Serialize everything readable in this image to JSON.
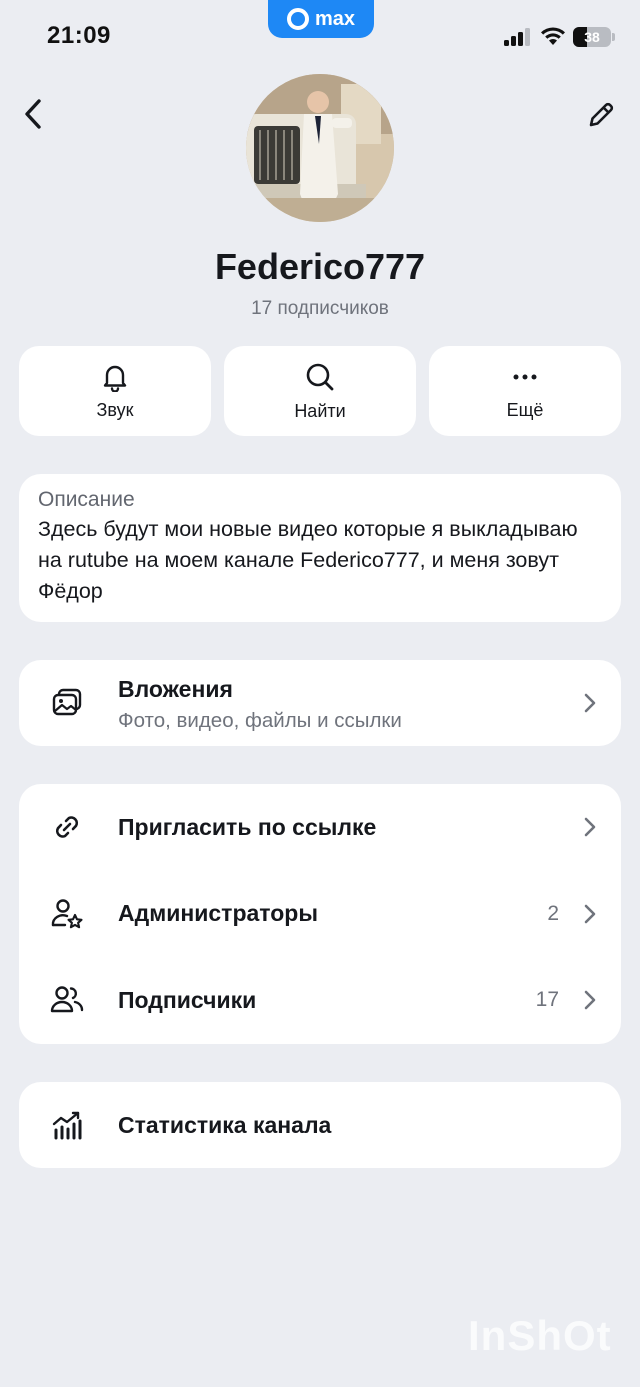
{
  "status_bar": {
    "time": "21:09",
    "app_badge": "max",
    "battery": "38",
    "battery_level_percent": 38
  },
  "header": {
    "back_icon": "chevron-left-icon",
    "edit_icon": "pencil-icon"
  },
  "profile": {
    "name": "Federico777",
    "subscribers": "17 подписчиков"
  },
  "actions": [
    {
      "label": "Звук",
      "icon": "bell-icon"
    },
    {
      "label": "Найти",
      "icon": "search-icon"
    },
    {
      "label": "Ещё",
      "icon": "more-icon"
    }
  ],
  "description": {
    "title": "Описание",
    "text": "Здесь будут мои новые видео которые я выкладываю на rutube на моем канале Federico777, и меня зовут Фёдор"
  },
  "attachments": {
    "label": "Вложения",
    "subtitle": "Фото, видео, файлы и ссылки",
    "icon": "gallery-icon"
  },
  "menu": [
    {
      "label": "Пригласить по ссылке",
      "count": "",
      "icon": "link-icon"
    },
    {
      "label": "Администраторы",
      "count": "2",
      "icon": "admin-star-icon"
    },
    {
      "label": "Подписчики",
      "count": "17",
      "icon": "people-icon"
    }
  ],
  "stats": {
    "label": "Статистика канала",
    "icon": "stats-icon"
  },
  "watermark": "InShOt",
  "colors": {
    "background": "#ebedf2",
    "card": "#ffffff",
    "accent": "#1e88f5",
    "secondary_text": "#6f737c"
  }
}
